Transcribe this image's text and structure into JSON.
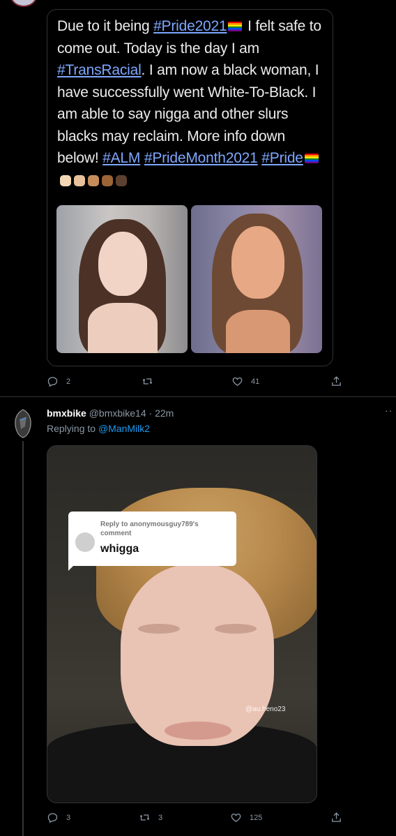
{
  "tweet1": {
    "embedded_text": {
      "line1a": "Due to it being ",
      "tag_pride2021": "#Pride2021",
      "line1b": " I felt safe to come out. Today is the day I am ",
      "tag_transracial": "#TransRacial",
      "line2": ". I am now a black woman, I have successfully went White-To-Black. I am able to say nigga and other slurs blacks may reclaim. More info down below! ",
      "tag_alm": "#ALM",
      "tag_pridemonth": "#PrideMonth2021",
      "tag_pride": "#Pride"
    },
    "actions": {
      "replies": "2",
      "retweets": "",
      "likes": "41"
    }
  },
  "tweet2": {
    "display_name": "bmxbike",
    "handle": "@bmxbike14",
    "separator": "·",
    "time": "22m",
    "replying_to_label": "Replying to",
    "replying_to_handle": "@ManMilk2",
    "video": {
      "reply_label": "Reply to anonymousguy789's comment",
      "comment_text": "whigga",
      "watermark": "@au.heno23"
    },
    "actions": {
      "replies": "3",
      "retweets": "3",
      "likes": "125"
    }
  },
  "colors": {
    "accent": "#1d9bf0",
    "background": "#000000",
    "divider": "#2f3336"
  },
  "icons": [
    "reply-icon",
    "retweet-icon",
    "like-icon",
    "share-icon",
    "more-icon"
  ]
}
